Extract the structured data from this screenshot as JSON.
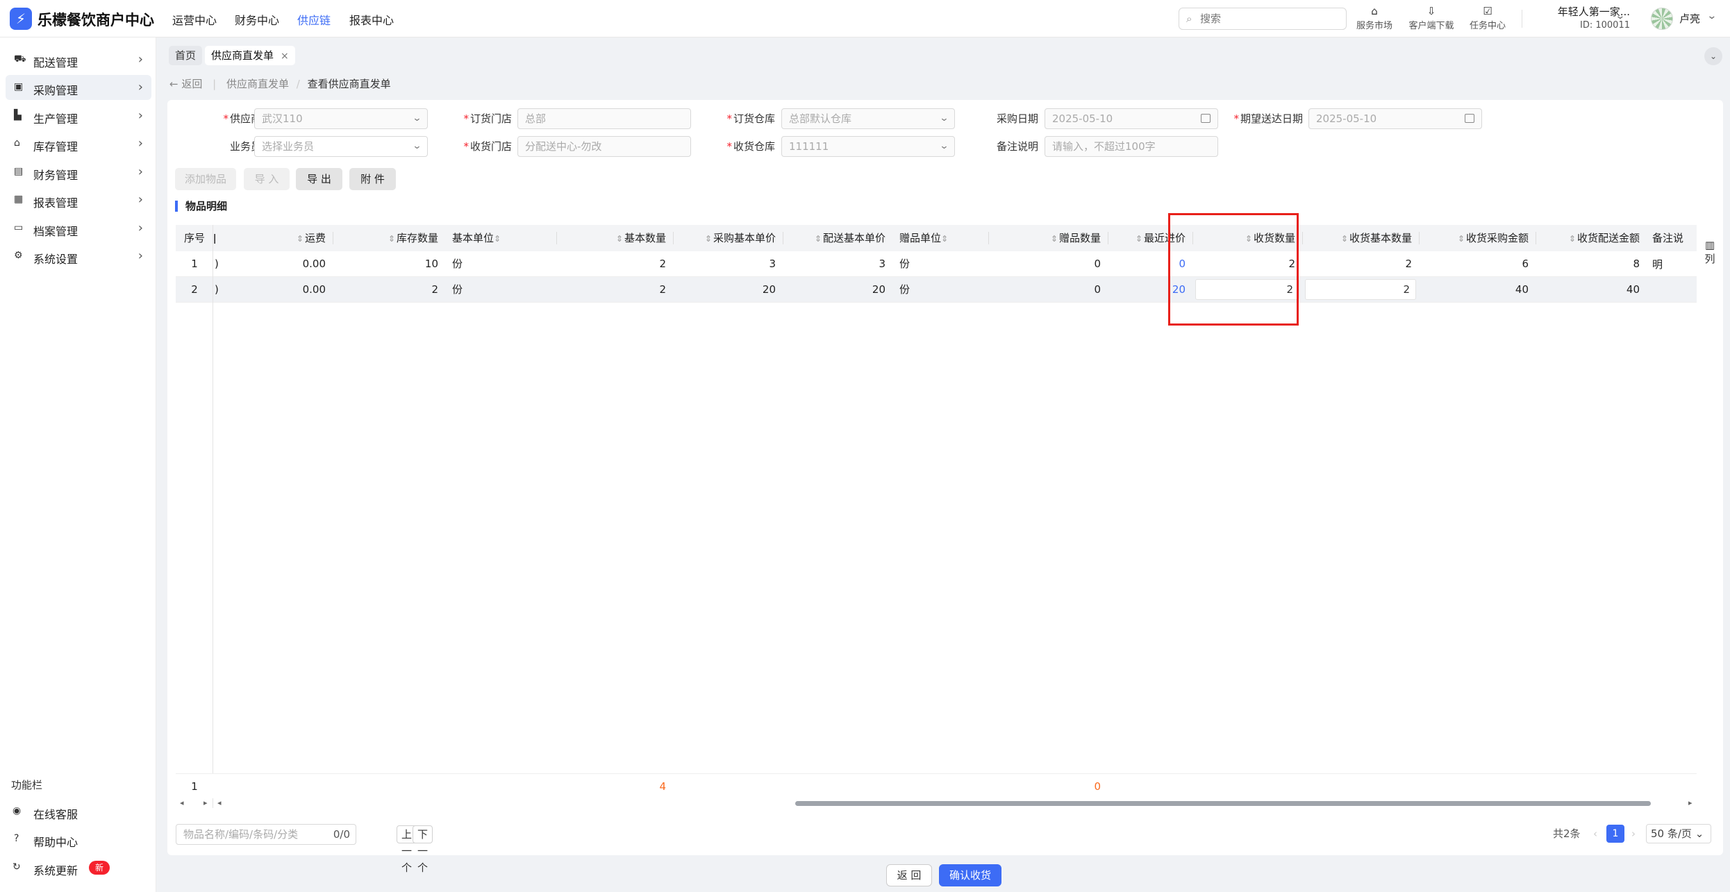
{
  "topbar": {
    "brand": "乐檬餐饮商户中心",
    "logo_glyph": "⚡",
    "nav": [
      "运营中心",
      "财务中心",
      "供应链",
      "报表中心"
    ],
    "active_nav": "供应链",
    "search_placeholder": "搜索",
    "tools": [
      {
        "icon": "shop-icon",
        "glyph": "⌂",
        "label": "服务市场"
      },
      {
        "icon": "download-folder-icon",
        "glyph": "⇩",
        "label": "客户端下载"
      },
      {
        "icon": "task-clipboard-icon",
        "glyph": "☑",
        "label": "任务中心"
      }
    ],
    "org_name": "年轻人第一家...",
    "org_id": "ID: 100011",
    "user_name": "卢亮"
  },
  "sidebar": {
    "items": [
      {
        "icon": "truck-icon",
        "glyph": "⛟",
        "label": "配送管理"
      },
      {
        "icon": "cart-icon",
        "glyph": "▣",
        "label": "采购管理"
      },
      {
        "icon": "factory-icon",
        "glyph": "▙",
        "label": "生产管理"
      },
      {
        "icon": "warehouse-icon",
        "glyph": "⌂",
        "label": "库存管理"
      },
      {
        "icon": "finance-icon",
        "glyph": "▤",
        "label": "财务管理"
      },
      {
        "icon": "report-icon",
        "glyph": "▦",
        "label": "报表管理"
      },
      {
        "icon": "archive-icon",
        "glyph": "▭",
        "label": "档案管理"
      },
      {
        "icon": "gear-icon",
        "glyph": "⚙",
        "label": "系统设置"
      }
    ],
    "active_item": "采购管理",
    "function_title": "功能栏",
    "functions": [
      {
        "icon": "headset-icon",
        "glyph": "◉",
        "label": "在线客服"
      },
      {
        "icon": "help-icon",
        "glyph": "?",
        "label": "帮助中心"
      },
      {
        "icon": "refresh-icon",
        "glyph": "↻",
        "label": "系统更新",
        "badge": "新"
      }
    ]
  },
  "tabs": {
    "home": "首页",
    "current": "供应商直发单",
    "close": "×"
  },
  "breadcrumb": {
    "back": "返回",
    "parent": "供应商直发单",
    "current": "查看供应商直发单",
    "sep": "/",
    "back_arrow": "←"
  },
  "form": {
    "supplier": {
      "label": "供应商",
      "value": "武汉110"
    },
    "order_store": {
      "label": "订货门店",
      "value": "总部"
    },
    "order_warehouse": {
      "label": "订货仓库",
      "value": "总部默认仓库"
    },
    "purchase_date": {
      "label": "采购日期",
      "value": "2025-05-10"
    },
    "expected_date": {
      "label": "期望送达日期",
      "value": "2025-05-10"
    },
    "salesman": {
      "label": "业务员",
      "placeholder": "选择业务员"
    },
    "receive_store": {
      "label": "收货门店",
      "value": "分配送中心-勿改"
    },
    "receive_warehouse": {
      "label": "收货仓库",
      "value": "111111"
    },
    "remark": {
      "label": "备注说明",
      "placeholder": "请输入，不超过100字"
    }
  },
  "buttons": {
    "add": "添加物品",
    "import": "导 入",
    "export": "导 出",
    "attach": "附 件"
  },
  "section_title": "物品明细",
  "columns": {
    "seq": "序号",
    "freight": "运费",
    "stock": "库存数量",
    "base_unit": "基本单位",
    "base_qty": "基本数量",
    "purchase_price": "采购基本单价",
    "dist_price": "配送基本单价",
    "gift_unit": "赠品单位",
    "gift_qty": "赠品数量",
    "recent_price": "最近进价",
    "recv_qty": "收货数量",
    "recv_base_qty": "收货基本数量",
    "recv_purchase_amt": "收货采购金额",
    "recv_dist_amt": "收货配送金额",
    "remark": "备注说明"
  },
  "rows": [
    {
      "seq": "1",
      "partial": ")",
      "freight": "0.00",
      "stock": "10",
      "base_unit": "份",
      "base_qty": "2",
      "purchase_price": "3",
      "dist_price": "3",
      "gift_unit": "份",
      "gift_qty": "0",
      "recent_price": "0",
      "recv_qty": "2",
      "recv_base_qty": "2",
      "recv_purchase_amt": "6",
      "recv_dist_amt": "8"
    },
    {
      "seq": "2",
      "partial": ")",
      "freight": "0.00",
      "stock": "2",
      "base_unit": "份",
      "base_qty": "2",
      "purchase_price": "20",
      "dist_price": "20",
      "gift_unit": "份",
      "gift_qty": "0",
      "recent_price": "20",
      "recv_qty": "2",
      "recv_base_qty": "2",
      "recv_purchase_amt": "40",
      "recv_dist_amt": "40"
    }
  ],
  "footer": {
    "count": "1",
    "base_qty_total": "4",
    "gift_qty_total": "0"
  },
  "col_settings": {
    "icon": "column-settings-icon",
    "glyph": "▥",
    "label": "列"
  },
  "bottom": {
    "search_placeholder": "物品名称/编码/条码/分类",
    "match": "0/0",
    "prev": "上一个",
    "next": "下一个"
  },
  "pager": {
    "total": "共2条",
    "page": "1",
    "size": "50 条/页"
  },
  "actions": {
    "back": "返 回",
    "confirm": "确认收货"
  },
  "colors": {
    "accent": "#3d6cf5",
    "highlight_box": "#e8201a",
    "total_orange": "#fa6a1e",
    "required": "#f5222d"
  }
}
